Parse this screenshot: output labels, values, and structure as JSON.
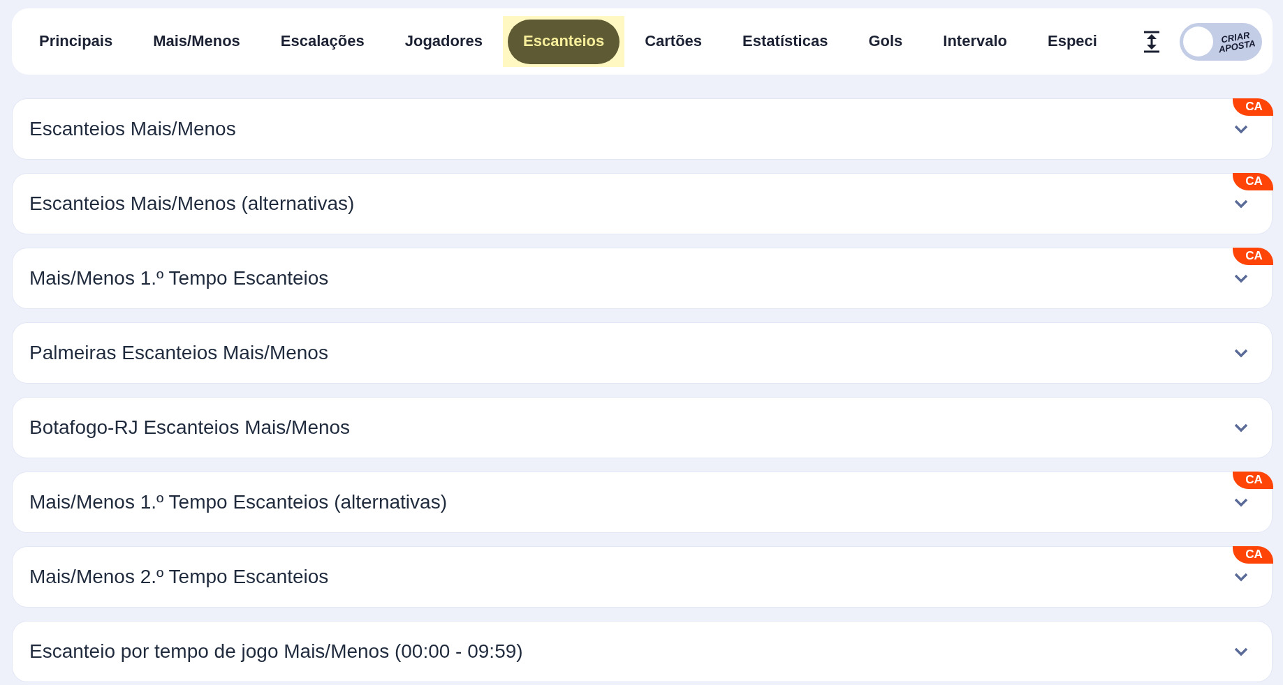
{
  "tabs": [
    {
      "label": "Principais",
      "selected": false,
      "highlighted": false
    },
    {
      "label": "Mais/Menos",
      "selected": false,
      "highlighted": false
    },
    {
      "label": "Escalações",
      "selected": false,
      "highlighted": false
    },
    {
      "label": "Jogadores",
      "selected": false,
      "highlighted": false
    },
    {
      "label": "Escanteios",
      "selected": true,
      "highlighted": true
    },
    {
      "label": "Cartões",
      "selected": false,
      "highlighted": false
    },
    {
      "label": "Estatísticas",
      "selected": false,
      "highlighted": false
    },
    {
      "label": "Gols",
      "selected": false,
      "highlighted": false
    },
    {
      "label": "Intervalo",
      "selected": false,
      "highlighted": false
    },
    {
      "label": "Especi",
      "selected": false,
      "highlighted": false
    }
  ],
  "create_bet": {
    "label": "CRIAR APOSTA",
    "on": false
  },
  "markets": [
    {
      "title": "Escanteios Mais/Menos",
      "badge": "CA",
      "expanded": false
    },
    {
      "title": "Escanteios Mais/Menos (alternativas)",
      "badge": "CA",
      "expanded": false
    },
    {
      "title": "Mais/Menos 1.º Tempo Escanteios",
      "badge": "CA",
      "expanded": false
    },
    {
      "title": "Palmeiras Escanteios Mais/Menos",
      "expanded": false
    },
    {
      "title": "Botafogo-RJ Escanteios Mais/Menos",
      "expanded": false
    },
    {
      "title": "Mais/Menos 1.º Tempo Escanteios (alternativas)",
      "badge": "CA",
      "expanded": false
    },
    {
      "title": "Mais/Menos 2.º Tempo Escanteios",
      "badge": "CA",
      "expanded": false
    },
    {
      "title": "Escanteio por tempo de jogo Mais/Menos (00:00 - 09:59)",
      "expanded": false
    }
  ]
}
